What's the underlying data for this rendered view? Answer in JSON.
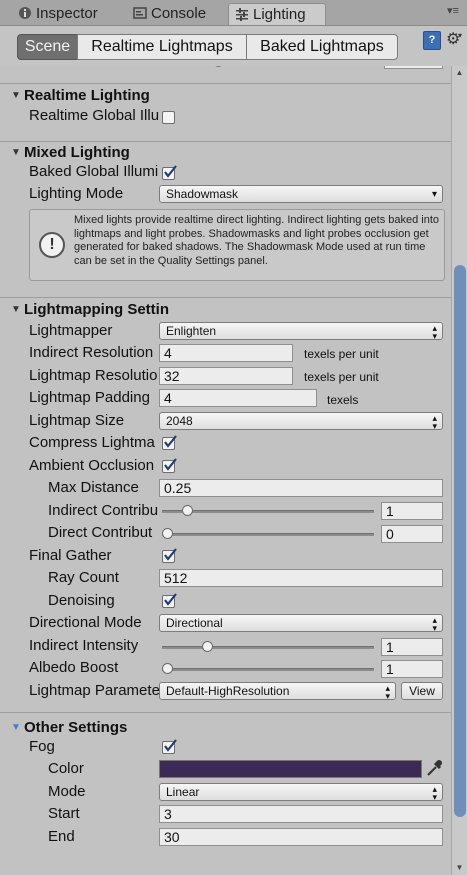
{
  "tabs": [
    {
      "label": "Inspector",
      "icon": "info-icon"
    },
    {
      "label": "Console",
      "icon": "console-icon"
    },
    {
      "label": "Lighting",
      "icon": "lighting-sliders-icon",
      "active": true
    }
  ],
  "toolbar": {
    "modes": [
      "Scene",
      "Realtime Lightmaps",
      "Baked Lightmaps"
    ],
    "active_mode": "Scene",
    "help_icon": "book-help-icon",
    "settings_icon": "gear-icon"
  },
  "realtime_lighting": {
    "title": "Realtime Lighting",
    "global_illumination_label": "Realtime Global Illu",
    "global_illumination": false
  },
  "mixed_lighting": {
    "title": "Mixed Lighting",
    "baked_gi_label": "Baked Global Illumi",
    "baked_gi": true,
    "lighting_mode_label": "Lighting Mode",
    "lighting_mode": "Shadowmask",
    "help_text": "Mixed lights provide realtime direct lighting. Indirect lighting gets baked into lightmaps and light probes. Shadowmasks and light probes occlusion get generated for baked shadows. The Shadowmask Mode used at run time can be set in the Quality Settings panel."
  },
  "lightmapping": {
    "title": "Lightmapping Settin",
    "lightmapper_label": "Lightmapper",
    "lightmapper": "Enlighten",
    "indirect_resolution_label": "Indirect Resolution",
    "indirect_resolution": "4",
    "indirect_resolution_unit": "texels per unit",
    "lightmap_resolution_label": "Lightmap Resolutio",
    "lightmap_resolution": "32",
    "lightmap_resolution_unit": "texels per unit",
    "lightmap_padding_label": "Lightmap Padding",
    "lightmap_padding": "4",
    "lightmap_padding_unit": "texels",
    "lightmap_size_label": "Lightmap Size",
    "lightmap_size": "2048",
    "compress_label": "Compress Lightma",
    "compress": true,
    "ambient_occlusion_label": "Ambient Occlusion",
    "ambient_occlusion": true,
    "max_distance_label": "Max Distance",
    "max_distance": "0.25",
    "indirect_contribution_label": "Indirect Contribu",
    "indirect_contribution": "1",
    "indirect_contribution_level": 0.1,
    "direct_contribution_label": "Direct Contribut",
    "direct_contribution": "0",
    "direct_contribution_level": 0.0,
    "final_gather_label": "Final Gather",
    "final_gather": true,
    "ray_count_label": "Ray Count",
    "ray_count": "512",
    "denoising_label": "Denoising",
    "denoising": true,
    "directional_mode_label": "Directional Mode",
    "directional_mode": "Directional",
    "indirect_intensity_label": "Indirect Intensity",
    "indirect_intensity": "1",
    "indirect_intensity_level": 0.2,
    "albedo_boost_label": "Albedo Boost",
    "albedo_boost": "1",
    "albedo_boost_level": 0.0,
    "parameters_label": "Lightmap Paramete",
    "parameters": "Default-HighResolution",
    "view_label": "View"
  },
  "other_settings": {
    "title": "Other Settings",
    "fog_label": "Fog",
    "fog": true,
    "color_label": "Color",
    "color_value": "#3b2a55",
    "mode_label": "Mode",
    "mode": "Linear",
    "start_label": "Start",
    "start": "3",
    "end_label": "End",
    "end": "30"
  }
}
